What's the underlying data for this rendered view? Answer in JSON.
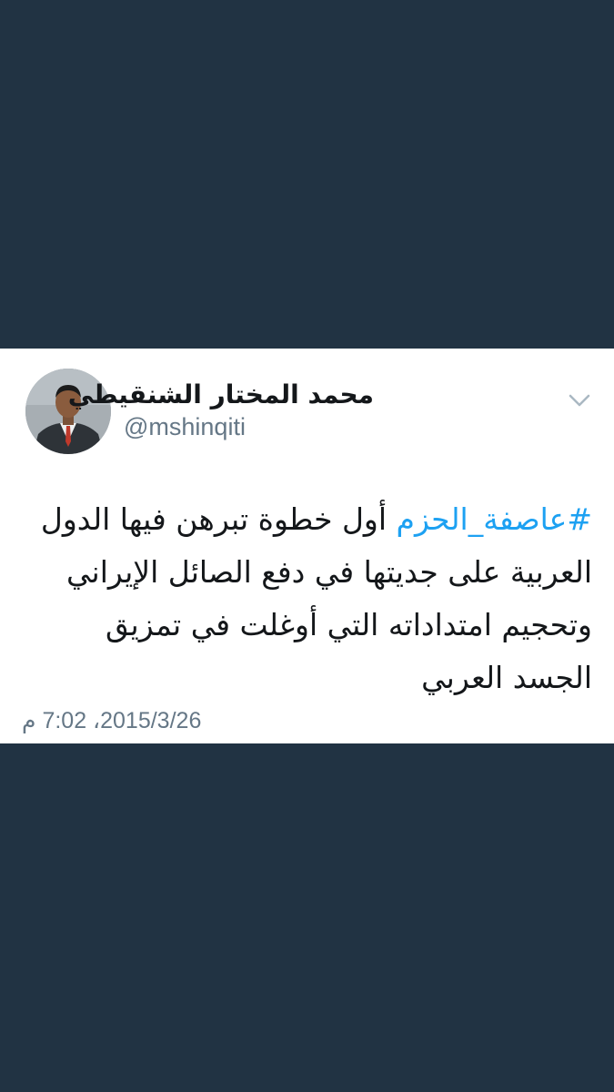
{
  "colors": {
    "background": "#213343",
    "card": "#ffffff",
    "text": "#14171a",
    "secondary": "#657786",
    "hashtag": "#1da1f2"
  },
  "tweet": {
    "author": {
      "display_name": "محمد المختار الشنقيطي",
      "handle": "@mshinqiti",
      "avatar_icon": "profile-photo"
    },
    "menu_icon": "chevron-down-icon",
    "hashtag": "#عاصفة_الحزم",
    "text_lines": [
      " أول خطوة تبرهن فيها الدول",
      "العربية على جديتها في دفع الصائل الإيراني",
      "وتحجيم امتداداته التي أوغلت في تمزيق",
      "الجسد العربي"
    ],
    "timestamp": "2015/3/26، 7:02 م"
  }
}
